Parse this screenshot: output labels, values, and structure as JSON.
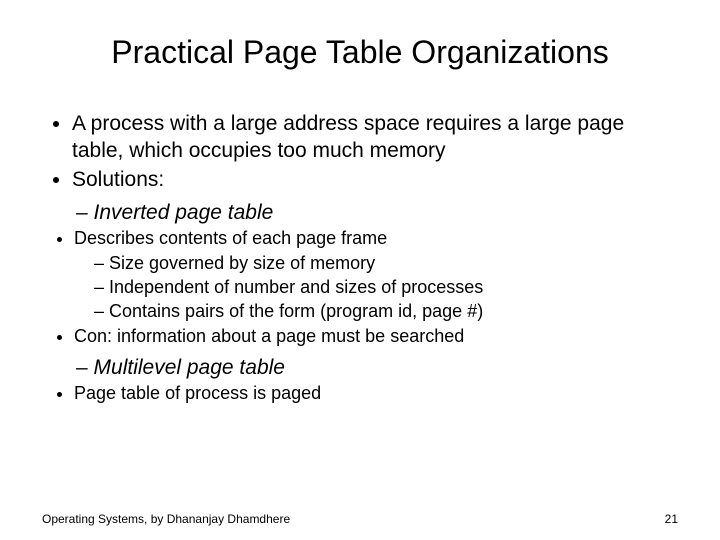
{
  "title": "Practical Page Table Organizations",
  "bullets": {
    "b1": "A process with a large address space requires a large page table, which occupies too much memory",
    "b2": "Solutions:",
    "s1": "Inverted page table",
    "s1a": "Describes contents of each page frame",
    "s1a1": "Size governed by size of memory",
    "s1a2": "Independent of number and sizes of processes",
    "s1a3": "Contains pairs of the form (program id, page #)",
    "s1b": "Con: information about a page must be searched",
    "s2": "Multilevel page table",
    "s2a": "Page table of process is paged"
  },
  "footer": {
    "left": "Operating Systems, by Dhananjay Dhamdhere",
    "right": "21"
  }
}
